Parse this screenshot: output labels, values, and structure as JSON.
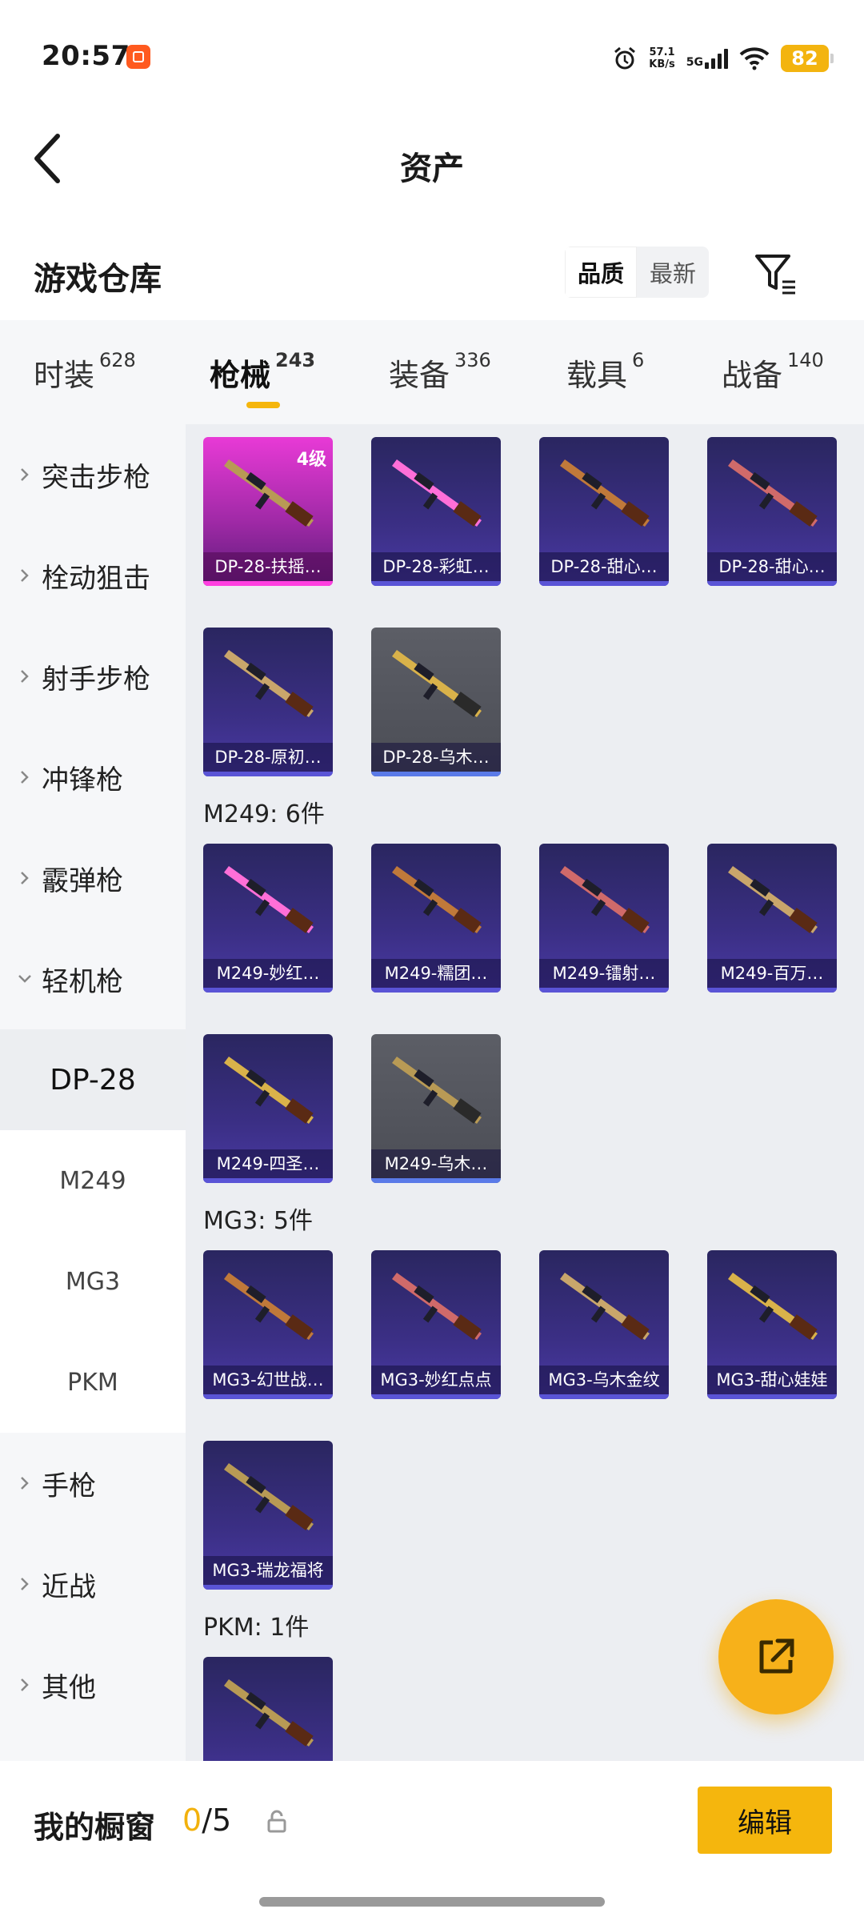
{
  "status": {
    "time": "20:57",
    "net_speed": "57.1",
    "net_unit": "KB/s",
    "network": "5G",
    "battery": "82"
  },
  "header": {
    "title": "资产"
  },
  "warehouse": {
    "label": "游戏仓库",
    "sort_quality": "品质",
    "sort_newest": "最新"
  },
  "tabs": [
    {
      "label": "时装",
      "count": "628"
    },
    {
      "label": "枪械",
      "count": "243"
    },
    {
      "label": "装备",
      "count": "336"
    },
    {
      "label": "载具",
      "count": "6"
    },
    {
      "label": "战备",
      "count": "140"
    }
  ],
  "sidebar": {
    "categories": [
      "突击步枪",
      "栓动狙击",
      "射手步枪",
      "冲锋枪",
      "霰弹枪",
      "轻机枪"
    ],
    "subs": [
      "DP-28",
      "M249",
      "MG3",
      "PKM"
    ],
    "after": [
      "手枪",
      "近战",
      "其他"
    ]
  },
  "groups": {
    "m249": "M249: 6件",
    "mg3": "MG3: 5件",
    "pkm": "PKM: 1件"
  },
  "cards": {
    "dp28": [
      "DP-28-扶摇…",
      "DP-28-彩虹…",
      "DP-28-甜心…",
      "DP-28-甜心…",
      "DP-28-原初…",
      "DP-28-乌木…"
    ],
    "m249": [
      "M249-妙红…",
      "M249-糯团…",
      "M249-镭射…",
      "M249-百万…",
      "M249-四圣…",
      "M249-乌木…"
    ],
    "mg3": [
      "MG3-幻世战…",
      "MG3-妙红点点",
      "MG3-乌木金纹",
      "MG3-甜心娃娃",
      "MG3-瑞龙福将"
    ],
    "first_level": "4级"
  },
  "bottom": {
    "label": "我的橱窗",
    "count_current": "0",
    "count_sep": "/5",
    "edit": "编辑"
  },
  "colors": {
    "accent": "#f5b60d",
    "card_bg": "#3b2f85",
    "rare": "#e83ad6"
  }
}
